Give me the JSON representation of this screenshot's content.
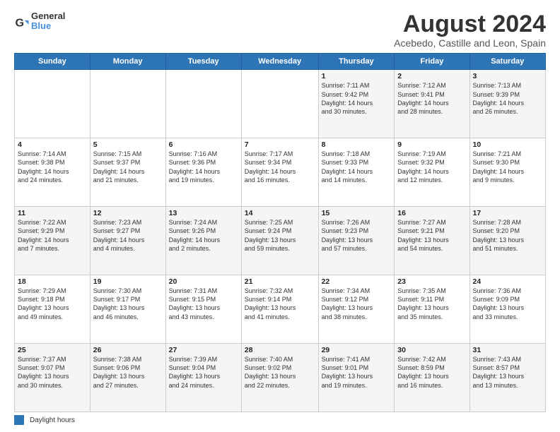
{
  "header": {
    "logo_general": "General",
    "logo_blue": "Blue",
    "title": "August 2024",
    "subtitle": "Acebedo, Castille and Leon, Spain"
  },
  "days_of_week": [
    "Sunday",
    "Monday",
    "Tuesday",
    "Wednesday",
    "Thursday",
    "Friday",
    "Saturday"
  ],
  "weeks": [
    [
      {
        "day": "",
        "info": ""
      },
      {
        "day": "",
        "info": ""
      },
      {
        "day": "",
        "info": ""
      },
      {
        "day": "",
        "info": ""
      },
      {
        "day": "1",
        "info": "Sunrise: 7:11 AM\nSunset: 9:42 PM\nDaylight: 14 hours\nand 30 minutes."
      },
      {
        "day": "2",
        "info": "Sunrise: 7:12 AM\nSunset: 9:41 PM\nDaylight: 14 hours\nand 28 minutes."
      },
      {
        "day": "3",
        "info": "Sunrise: 7:13 AM\nSunset: 9:39 PM\nDaylight: 14 hours\nand 26 minutes."
      }
    ],
    [
      {
        "day": "4",
        "info": "Sunrise: 7:14 AM\nSunset: 9:38 PM\nDaylight: 14 hours\nand 24 minutes."
      },
      {
        "day": "5",
        "info": "Sunrise: 7:15 AM\nSunset: 9:37 PM\nDaylight: 14 hours\nand 21 minutes."
      },
      {
        "day": "6",
        "info": "Sunrise: 7:16 AM\nSunset: 9:36 PM\nDaylight: 14 hours\nand 19 minutes."
      },
      {
        "day": "7",
        "info": "Sunrise: 7:17 AM\nSunset: 9:34 PM\nDaylight: 14 hours\nand 16 minutes."
      },
      {
        "day": "8",
        "info": "Sunrise: 7:18 AM\nSunset: 9:33 PM\nDaylight: 14 hours\nand 14 minutes."
      },
      {
        "day": "9",
        "info": "Sunrise: 7:19 AM\nSunset: 9:32 PM\nDaylight: 14 hours\nand 12 minutes."
      },
      {
        "day": "10",
        "info": "Sunrise: 7:21 AM\nSunset: 9:30 PM\nDaylight: 14 hours\nand 9 minutes."
      }
    ],
    [
      {
        "day": "11",
        "info": "Sunrise: 7:22 AM\nSunset: 9:29 PM\nDaylight: 14 hours\nand 7 minutes."
      },
      {
        "day": "12",
        "info": "Sunrise: 7:23 AM\nSunset: 9:27 PM\nDaylight: 14 hours\nand 4 minutes."
      },
      {
        "day": "13",
        "info": "Sunrise: 7:24 AM\nSunset: 9:26 PM\nDaylight: 14 hours\nand 2 minutes."
      },
      {
        "day": "14",
        "info": "Sunrise: 7:25 AM\nSunset: 9:24 PM\nDaylight: 13 hours\nand 59 minutes."
      },
      {
        "day": "15",
        "info": "Sunrise: 7:26 AM\nSunset: 9:23 PM\nDaylight: 13 hours\nand 57 minutes."
      },
      {
        "day": "16",
        "info": "Sunrise: 7:27 AM\nSunset: 9:21 PM\nDaylight: 13 hours\nand 54 minutes."
      },
      {
        "day": "17",
        "info": "Sunrise: 7:28 AM\nSunset: 9:20 PM\nDaylight: 13 hours\nand 51 minutes."
      }
    ],
    [
      {
        "day": "18",
        "info": "Sunrise: 7:29 AM\nSunset: 9:18 PM\nDaylight: 13 hours\nand 49 minutes."
      },
      {
        "day": "19",
        "info": "Sunrise: 7:30 AM\nSunset: 9:17 PM\nDaylight: 13 hours\nand 46 minutes."
      },
      {
        "day": "20",
        "info": "Sunrise: 7:31 AM\nSunset: 9:15 PM\nDaylight: 13 hours\nand 43 minutes."
      },
      {
        "day": "21",
        "info": "Sunrise: 7:32 AM\nSunset: 9:14 PM\nDaylight: 13 hours\nand 41 minutes."
      },
      {
        "day": "22",
        "info": "Sunrise: 7:34 AM\nSunset: 9:12 PM\nDaylight: 13 hours\nand 38 minutes."
      },
      {
        "day": "23",
        "info": "Sunrise: 7:35 AM\nSunset: 9:11 PM\nDaylight: 13 hours\nand 35 minutes."
      },
      {
        "day": "24",
        "info": "Sunrise: 7:36 AM\nSunset: 9:09 PM\nDaylight: 13 hours\nand 33 minutes."
      }
    ],
    [
      {
        "day": "25",
        "info": "Sunrise: 7:37 AM\nSunset: 9:07 PM\nDaylight: 13 hours\nand 30 minutes."
      },
      {
        "day": "26",
        "info": "Sunrise: 7:38 AM\nSunset: 9:06 PM\nDaylight: 13 hours\nand 27 minutes."
      },
      {
        "day": "27",
        "info": "Sunrise: 7:39 AM\nSunset: 9:04 PM\nDaylight: 13 hours\nand 24 minutes."
      },
      {
        "day": "28",
        "info": "Sunrise: 7:40 AM\nSunset: 9:02 PM\nDaylight: 13 hours\nand 22 minutes."
      },
      {
        "day": "29",
        "info": "Sunrise: 7:41 AM\nSunset: 9:01 PM\nDaylight: 13 hours\nand 19 minutes."
      },
      {
        "day": "30",
        "info": "Sunrise: 7:42 AM\nSunset: 8:59 PM\nDaylight: 13 hours\nand 16 minutes."
      },
      {
        "day": "31",
        "info": "Sunrise: 7:43 AM\nSunset: 8:57 PM\nDaylight: 13 hours\nand 13 minutes."
      }
    ]
  ],
  "footer": {
    "daylight_label": "Daylight hours"
  }
}
